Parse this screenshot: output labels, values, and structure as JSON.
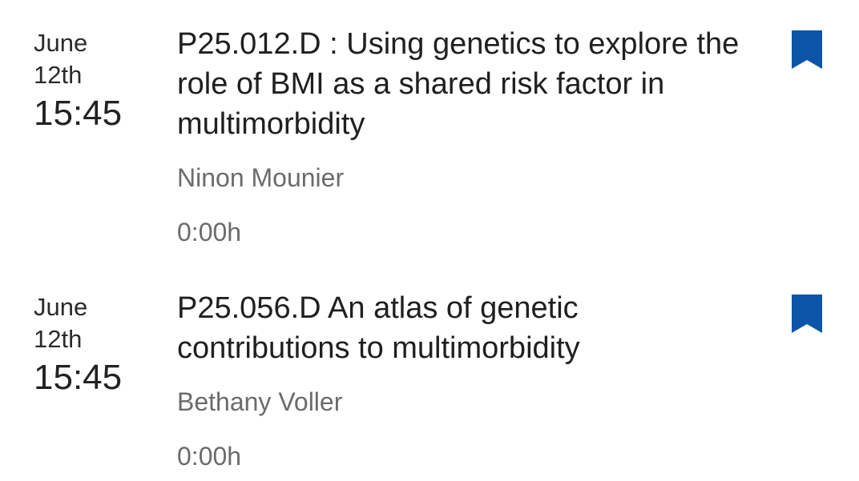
{
  "colors": {
    "bookmark": "#0b54a8",
    "title_text": "#1f1f1f",
    "secondary_text": "#6b6b6b"
  },
  "sessions": [
    {
      "month": "June",
      "day": "12th",
      "time": "15:45",
      "title": "P25.012.D : Using genetics to explore the role of BMI as a shared risk factor in multimorbidity",
      "speaker": "Ninon Mounier",
      "duration": "0:00h",
      "bookmark_icon": "bookmark-icon"
    },
    {
      "month": "June",
      "day": "12th",
      "time": "15:45",
      "title": "P25.056.D An atlas of genetic contributions to multimorbidity",
      "speaker": "Bethany Voller",
      "duration": "0:00h",
      "bookmark_icon": "bookmark-icon"
    }
  ]
}
